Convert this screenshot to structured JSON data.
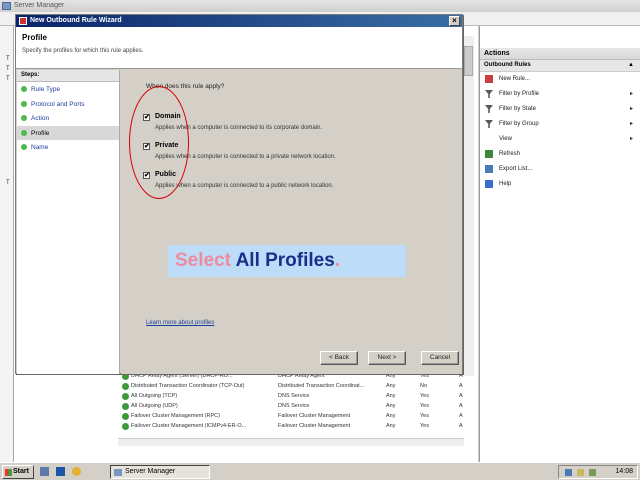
{
  "server_manager": {
    "title": "Server Manager",
    "actions_header": "Actions",
    "actions_sub": "Outbound Rules",
    "actions": [
      {
        "label": "New Rule...",
        "icon": "new-rule-icon",
        "arrow": ""
      },
      {
        "label": "Filter by Profile",
        "icon": "filter-icon",
        "arrow": "▸"
      },
      {
        "label": "Filter by State",
        "icon": "filter-icon",
        "arrow": "▸"
      },
      {
        "label": "Filter by Group",
        "icon": "filter-icon",
        "arrow": "▸"
      },
      {
        "label": "View",
        "icon": "",
        "arrow": "▸"
      },
      {
        "label": "Refresh",
        "icon": "refresh-icon",
        "arrow": ""
      },
      {
        "label": "Export List...",
        "icon": "export-icon",
        "arrow": ""
      },
      {
        "label": "Help",
        "icon": "help-icon",
        "arrow": ""
      }
    ],
    "left_letters": [
      "T",
      "T",
      "T",
      "T"
    ],
    "rows": [
      {
        "name": "DHCP Relay Agent (Server) (DHCP-RO...",
        "group": "DHCP Relay Agent",
        "profile": "Any",
        "enabled": "Yes",
        "action": "A"
      },
      {
        "name": "Distributed Transaction Coordinator (TCP-Out)",
        "group": "Distributed Transaction Coordinat...",
        "profile": "Any",
        "enabled": "No",
        "action": "A"
      },
      {
        "name": "All Outgoing (TCP)",
        "group": "DNS Service",
        "profile": "Any",
        "enabled": "Yes",
        "action": "A"
      },
      {
        "name": "All Outgoing (UDP)",
        "group": "DNS Service",
        "profile": "Any",
        "enabled": "Yes",
        "action": "A"
      },
      {
        "name": "Failover Cluster Management (RPC)",
        "group": "Failover Cluster Management",
        "profile": "Any",
        "enabled": "Yes",
        "action": "A"
      },
      {
        "name": "Failover Cluster Management (ICMPv4-ER-O...",
        "group": "Failover Cluster Management",
        "profile": "Any",
        "enabled": "Yes",
        "action": "A"
      }
    ]
  },
  "wizard": {
    "title": "New Outbound Rule Wizard",
    "close": "×",
    "header_title": "Profile",
    "header_desc": "Specify the profiles for which this rule applies.",
    "steps_header": "Steps:",
    "steps": [
      "Rule Type",
      "Protocol and Ports",
      "Action",
      "Profile",
      "Name"
    ],
    "question": "When does this rule apply?",
    "options": [
      {
        "label": "Domain",
        "desc": "Applies when a computer is connected to its corporate domain.",
        "checked": "✔"
      },
      {
        "label": "Private",
        "desc": "Applies when a computer is connected to a private network location.",
        "checked": "✔"
      },
      {
        "label": "Public",
        "desc": "Applies when a computer is connected to a public network location.",
        "checked": "✔"
      }
    ],
    "more_link": "Learn more about profiles",
    "back": "< Back",
    "next": "Next >",
    "cancel": "Cancel"
  },
  "banner": {
    "word1": "Select",
    "word2": "All Profiles",
    "dot": "."
  },
  "taskbar": {
    "start": "Start",
    "task": "Server Manager",
    "clock": "14:08"
  }
}
